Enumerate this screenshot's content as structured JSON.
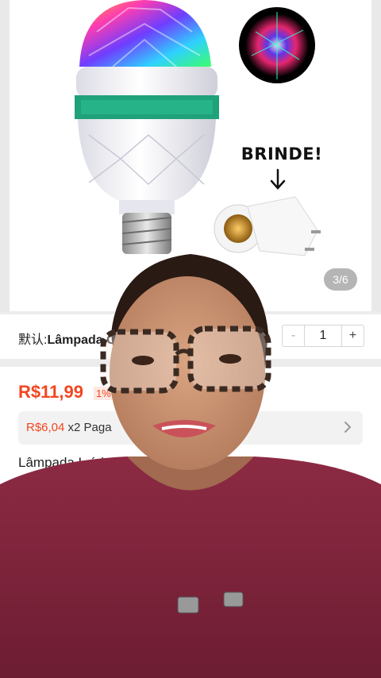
{
  "gallery": {
    "counter": "3/6",
    "brinde_label": "BRINDE!",
    "images": [
      "disco-ball-bulb",
      "projection-preview-thumbnail",
      "socket-adapter-gift"
    ]
  },
  "variant": {
    "key": "默认:",
    "value": "Lâmpada G"
  },
  "quantity": {
    "minus": "-",
    "value": "1",
    "plus": "+"
  },
  "pricing": {
    "price": "R$11,99",
    "discount": "1%",
    "installment_price": "R$6,04",
    "installment_text": " x2 Paga"
  },
  "product": {
    "title": "Lâmpada L                                ório Para Festa"
  },
  "colors": {
    "price": "#f3461f",
    "accent_green": "#1fa17a"
  }
}
